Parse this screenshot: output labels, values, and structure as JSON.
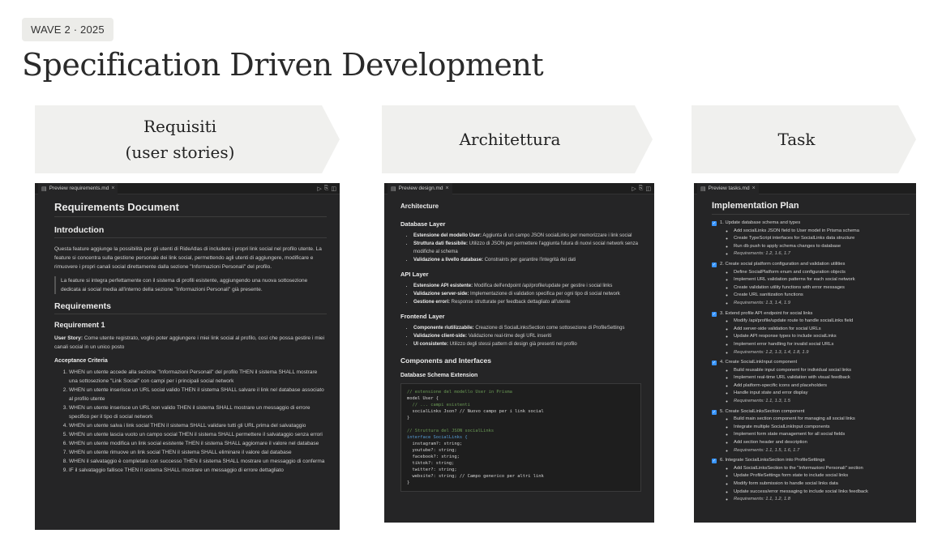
{
  "badge": "WAVE 2 · 2025",
  "title": "Specification Driven Development",
  "columns": [
    {
      "label": "Requisiti\n(user stories)"
    },
    {
      "label": "Architettura"
    },
    {
      "label": "Task"
    }
  ],
  "pane1": {
    "tab": "Preview requirements.md",
    "h1": "Requirements Document",
    "intro_heading": "Introduction",
    "intro_p": "Questa feature aggiunge la possibilità per gli utenti di RideAtlas di includere i propri link social nel profilo utente. La feature si concentra sulla gestione personale dei link social, permettendo agli utenti di aggiungere, modificare e rimuovere i propri canali social direttamente dalla sezione \"Informazioni Personali\" del profilo.",
    "quote": "La feature si integra perfettamente con il sistema di profili esistente, aggiungendo una nuova sottosezione dedicata ai social media all'interno della sezione \"Informazioni Personali\" già presente.",
    "req_heading": "Requirements",
    "req1": "Requirement 1",
    "story_label": "User Story:",
    "story": " Come utente registrato, voglio poter aggiungere i miei link social al profilo, così che possa gestire i miei canali social in un unico posto",
    "ac": "Acceptance Criteria",
    "criteria": [
      "WHEN un utente accede alla sezione \"Informazioni Personali\" del profilo THEN il sistema SHALL mostrare una sottosezione \"Link Social\" con campi per i principali social network",
      "WHEN un utente inserisce un URL social valido THEN il sistema SHALL salvare il link nel database associato al profilo utente",
      "WHEN un utente inserisce un URL non valido THEN il sistema SHALL mostrare un messaggio di errore specifico per il tipo di social network",
      "WHEN un utente salva i link social THEN il sistema SHALL validare tutti gli URL prima del salvataggio",
      "WHEN un utente lascia vuoto un campo social THEN il sistema SHALL permettere il salvataggio senza errori",
      "WHEN un utente modifica un link social esistente THEN il sistema SHALL aggiornare il valore nel database",
      "WHEN un utente rimuove un link social THEN il sistema SHALL eliminare il valore dal database",
      "WHEN il salvataggio è completato con successo THEN il sistema SHALL mostrare un messaggio di conferma",
      "IF il salvataggio fallisce THEN il sistema SHALL mostrare un messaggio di errore dettagliato"
    ]
  },
  "pane2": {
    "tab": "Preview design.md",
    "h2": "Architecture",
    "db_heading": "Database Layer",
    "db_items": [
      {
        "b": "Estensione del modello User:",
        "t": " Aggiunta di un campo JSON socialLinks per memorizzare i link social"
      },
      {
        "b": "Struttura dati flessibile:",
        "t": " Utilizzo di JSON per permettere l'aggiunta futura di nuovi social network senza modifiche al schema"
      },
      {
        "b": "Validazione a livello database:",
        "t": " Constraints per garantire l'integrità dei dati"
      }
    ],
    "api_heading": "API Layer",
    "api_items": [
      {
        "b": "Estensione API esistente:",
        "t": " Modifica dell'endpoint /api/profile/update per gestire i social links"
      },
      {
        "b": "Validazione server-side:",
        "t": " Implementazione di validation specifica per ogni tipo di social network"
      },
      {
        "b": "Gestione errori:",
        "t": " Response strutturate per feedback dettagliato all'utente"
      }
    ],
    "fe_heading": "Frontend Layer",
    "fe_items": [
      {
        "b": "Componente riutilizzabile:",
        "t": " Creazione di SocialLinksSection come sottosezione di ProfileSettings"
      },
      {
        "b": "Validazione client-side:",
        "t": " Validazione real-time degli URL inseriti"
      },
      {
        "b": "UI consistente:",
        "t": " Utilizzo degli stessi pattern di design già presenti nel profilo"
      }
    ],
    "ci_heading": "Components and Interfaces",
    "schema_heading": "Database Schema Extension",
    "code": [
      {
        "cls": "c",
        "t": "// estensione del modello User in Prisma"
      },
      {
        "cls": "",
        "t": "model User {"
      },
      {
        "cls": "c",
        "t": "  // ... campi esistenti"
      },
      {
        "cls": "",
        "t": "  socialLinks Json? // Nuovo campo per i link social"
      },
      {
        "cls": "",
        "t": "}"
      },
      {
        "cls": "",
        "t": " "
      },
      {
        "cls": "c",
        "t": "// Struttura del JSON socialLinks"
      },
      {
        "cls": "k",
        "t": "interface SocialLinks {"
      },
      {
        "cls": "",
        "t": "  instagram?: string;"
      },
      {
        "cls": "",
        "t": "  youtube?: string;"
      },
      {
        "cls": "",
        "t": "  facebook?: string;"
      },
      {
        "cls": "",
        "t": "  tiktok?: string;"
      },
      {
        "cls": "",
        "t": "  twitter?: string;"
      },
      {
        "cls": "",
        "t": "  website?: string; // Campo generico per altri link"
      },
      {
        "cls": "",
        "t": "}"
      }
    ]
  },
  "pane3": {
    "tab": "Preview tasks.md",
    "h1": "Implementation Plan",
    "tasks": [
      {
        "title": "1. Update database schema and types",
        "items": [
          "Add socialLinks JSON field to User model in Prisma schema",
          "Create TypeScript interfaces for SocialLinks data structure",
          "Run db push to apply schema changes to database"
        ],
        "req": "Requirements: 1.2, 1.6, 1.7"
      },
      {
        "title": "2. Create social platform configuration and validation utilities",
        "items": [
          "Define SocialPlatform enum and configuration objects",
          "Implement URL validation patterns for each social network",
          "Create validation utility functions with error messages",
          "Create URL sanitization functions"
        ],
        "req": "Requirements: 1.3, 1.4, 1.9"
      },
      {
        "title": "3. Extend profile API endpoint for social links",
        "items": [
          "Modify /api/profile/update route to handle socialLinks field",
          "Add server-side validation for social URLs",
          "Update API response types to include socialLinks",
          "Implement error handling for invalid social URLs"
        ],
        "req": "Requirements: 1.2, 1.3, 1.4, 1.8, 1.9"
      },
      {
        "title": "4. Create SocialLinkInput component",
        "items": [
          "Build reusable input component for individual social links",
          "Implement real-time URL validation with visual feedback",
          "Add platform-specific icons and placeholders",
          "Handle input state and error display"
        ],
        "req": "Requirements: 1.1, 1.3, 1.5"
      },
      {
        "title": "5. Create SocialLinksSection component",
        "items": [
          "Build main section component for managing all social links",
          "Integrate multiple SocialLinkInput components",
          "Implement form state management for all social fields",
          "Add section header and description"
        ],
        "req": "Requirements: 1.1, 1.5, 1.6, 1.7"
      },
      {
        "title": "6. Integrate SocialLinksSection into ProfileSettings",
        "items": [
          "Add SocialLinksSection to the \"Informazioni Personali\" section",
          "Update ProfileSettings form state to include social links",
          "Modify form submission to handle social links data",
          "Update success/error messaging to include social links feedback"
        ],
        "req": "Requirements: 1.1, 1.2, 1.8"
      }
    ]
  }
}
